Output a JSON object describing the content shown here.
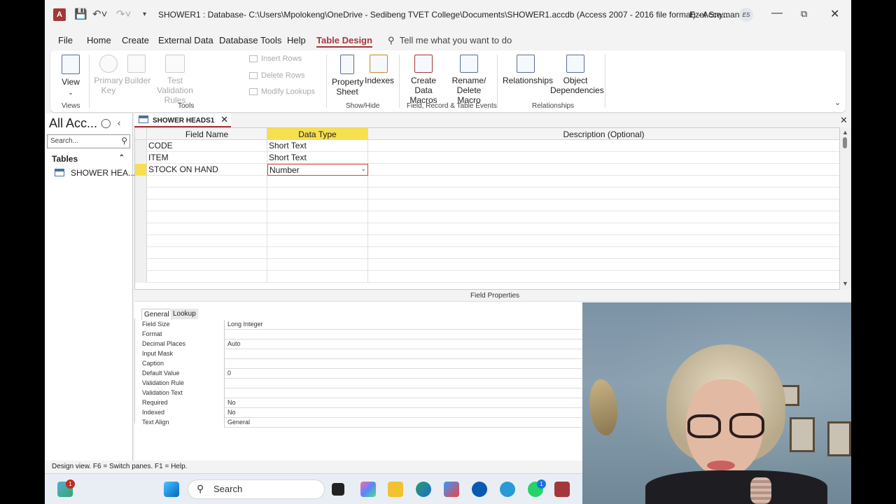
{
  "titlebar": {
    "app_icon": "A",
    "title": "SHOWER1 : Database- C:\\Users\\Mpolokeng\\OneDrive - Sedibeng TVET College\\Documents\\SHOWER1.accdb (Access 2007 - 2016 file format)  -  Acce...",
    "user_name": "Ezet Snyman",
    "user_initials": "ES",
    "icons": [
      "save-icon",
      "undo-icon",
      "redo-icon",
      "customize-qat-icon"
    ],
    "window_buttons": [
      "minimize",
      "restore",
      "close"
    ]
  },
  "menu": {
    "tabs": [
      "File",
      "Home",
      "Create",
      "External Data",
      "Database Tools",
      "Help",
      "Table Design"
    ],
    "active_tab": "Table Design",
    "tell_me": "Tell me what you want to do"
  },
  "ribbon": {
    "views": {
      "view_label": "View",
      "group": "Views"
    },
    "tools": {
      "primary_key": "Primary Key",
      "builder": "Builder",
      "test_validation": "Test Validation Rules",
      "insert_rows": "Insert Rows",
      "delete_rows": "Delete Rows",
      "modify_lookups": "Modify Lookups",
      "group": "Tools"
    },
    "show_hide": {
      "property_sheet": "Property Sheet",
      "indexes": "Indexes",
      "group": "Show/Hide"
    },
    "events": {
      "create_data_macros": "Create Data Macros",
      "rename_delete_macro": "Rename/ Delete Macro",
      "group": "Field, Record & Table Events"
    },
    "relationships": {
      "relationships": "Relationships",
      "object_dependencies": "Object Dependencies",
      "group": "Relationships"
    }
  },
  "nav": {
    "title": "All Acc...",
    "search_placeholder": "Search...",
    "group": "Tables",
    "items": [
      "SHOWER HEA..."
    ]
  },
  "document": {
    "tab_label": "SHOWER HEADS1",
    "columns": [
      "Field Name",
      "Data Type",
      "Description (Optional)"
    ],
    "rows": [
      {
        "field": "CODE",
        "type": "Short Text",
        "desc": ""
      },
      {
        "field": "ITEM",
        "type": "Short Text",
        "desc": ""
      },
      {
        "field": "STOCK ON HAND",
        "type": "Number",
        "desc": ""
      }
    ]
  },
  "field_properties": {
    "title": "Field Properties",
    "tabs": [
      "General",
      "Lookup"
    ],
    "active_tab": "General",
    "properties": [
      {
        "name": "Field Size",
        "value": "Long Integer"
      },
      {
        "name": "Format",
        "value": ""
      },
      {
        "name": "Decimal Places",
        "value": "Auto"
      },
      {
        "name": "Input Mask",
        "value": ""
      },
      {
        "name": "Caption",
        "value": ""
      },
      {
        "name": "Default Value",
        "value": "0"
      },
      {
        "name": "Validation Rule",
        "value": ""
      },
      {
        "name": "Validation Text",
        "value": ""
      },
      {
        "name": "Required",
        "value": "No"
      },
      {
        "name": "Indexed",
        "value": "No"
      },
      {
        "name": "Text Align",
        "value": "General"
      }
    ]
  },
  "statusbar": {
    "text": "Design view.  F6 = Switch panes.  F1 = Help."
  },
  "taskbar": {
    "search_label": "Search",
    "copilot_badge": "1",
    "whatsapp_badge": "1",
    "apps": [
      "copilot-icon",
      "start-icon",
      "search-icon",
      "task-view-icon",
      "copilot-app-icon",
      "file-explorer-icon",
      "edge-icon",
      "store-icon",
      "hp-icon",
      "help-icon",
      "whatsapp-icon",
      "access-icon"
    ]
  },
  "colors": {
    "accent": "#a4373a",
    "highlight": "#f7e04e",
    "taskbar": "#e9eef5"
  }
}
